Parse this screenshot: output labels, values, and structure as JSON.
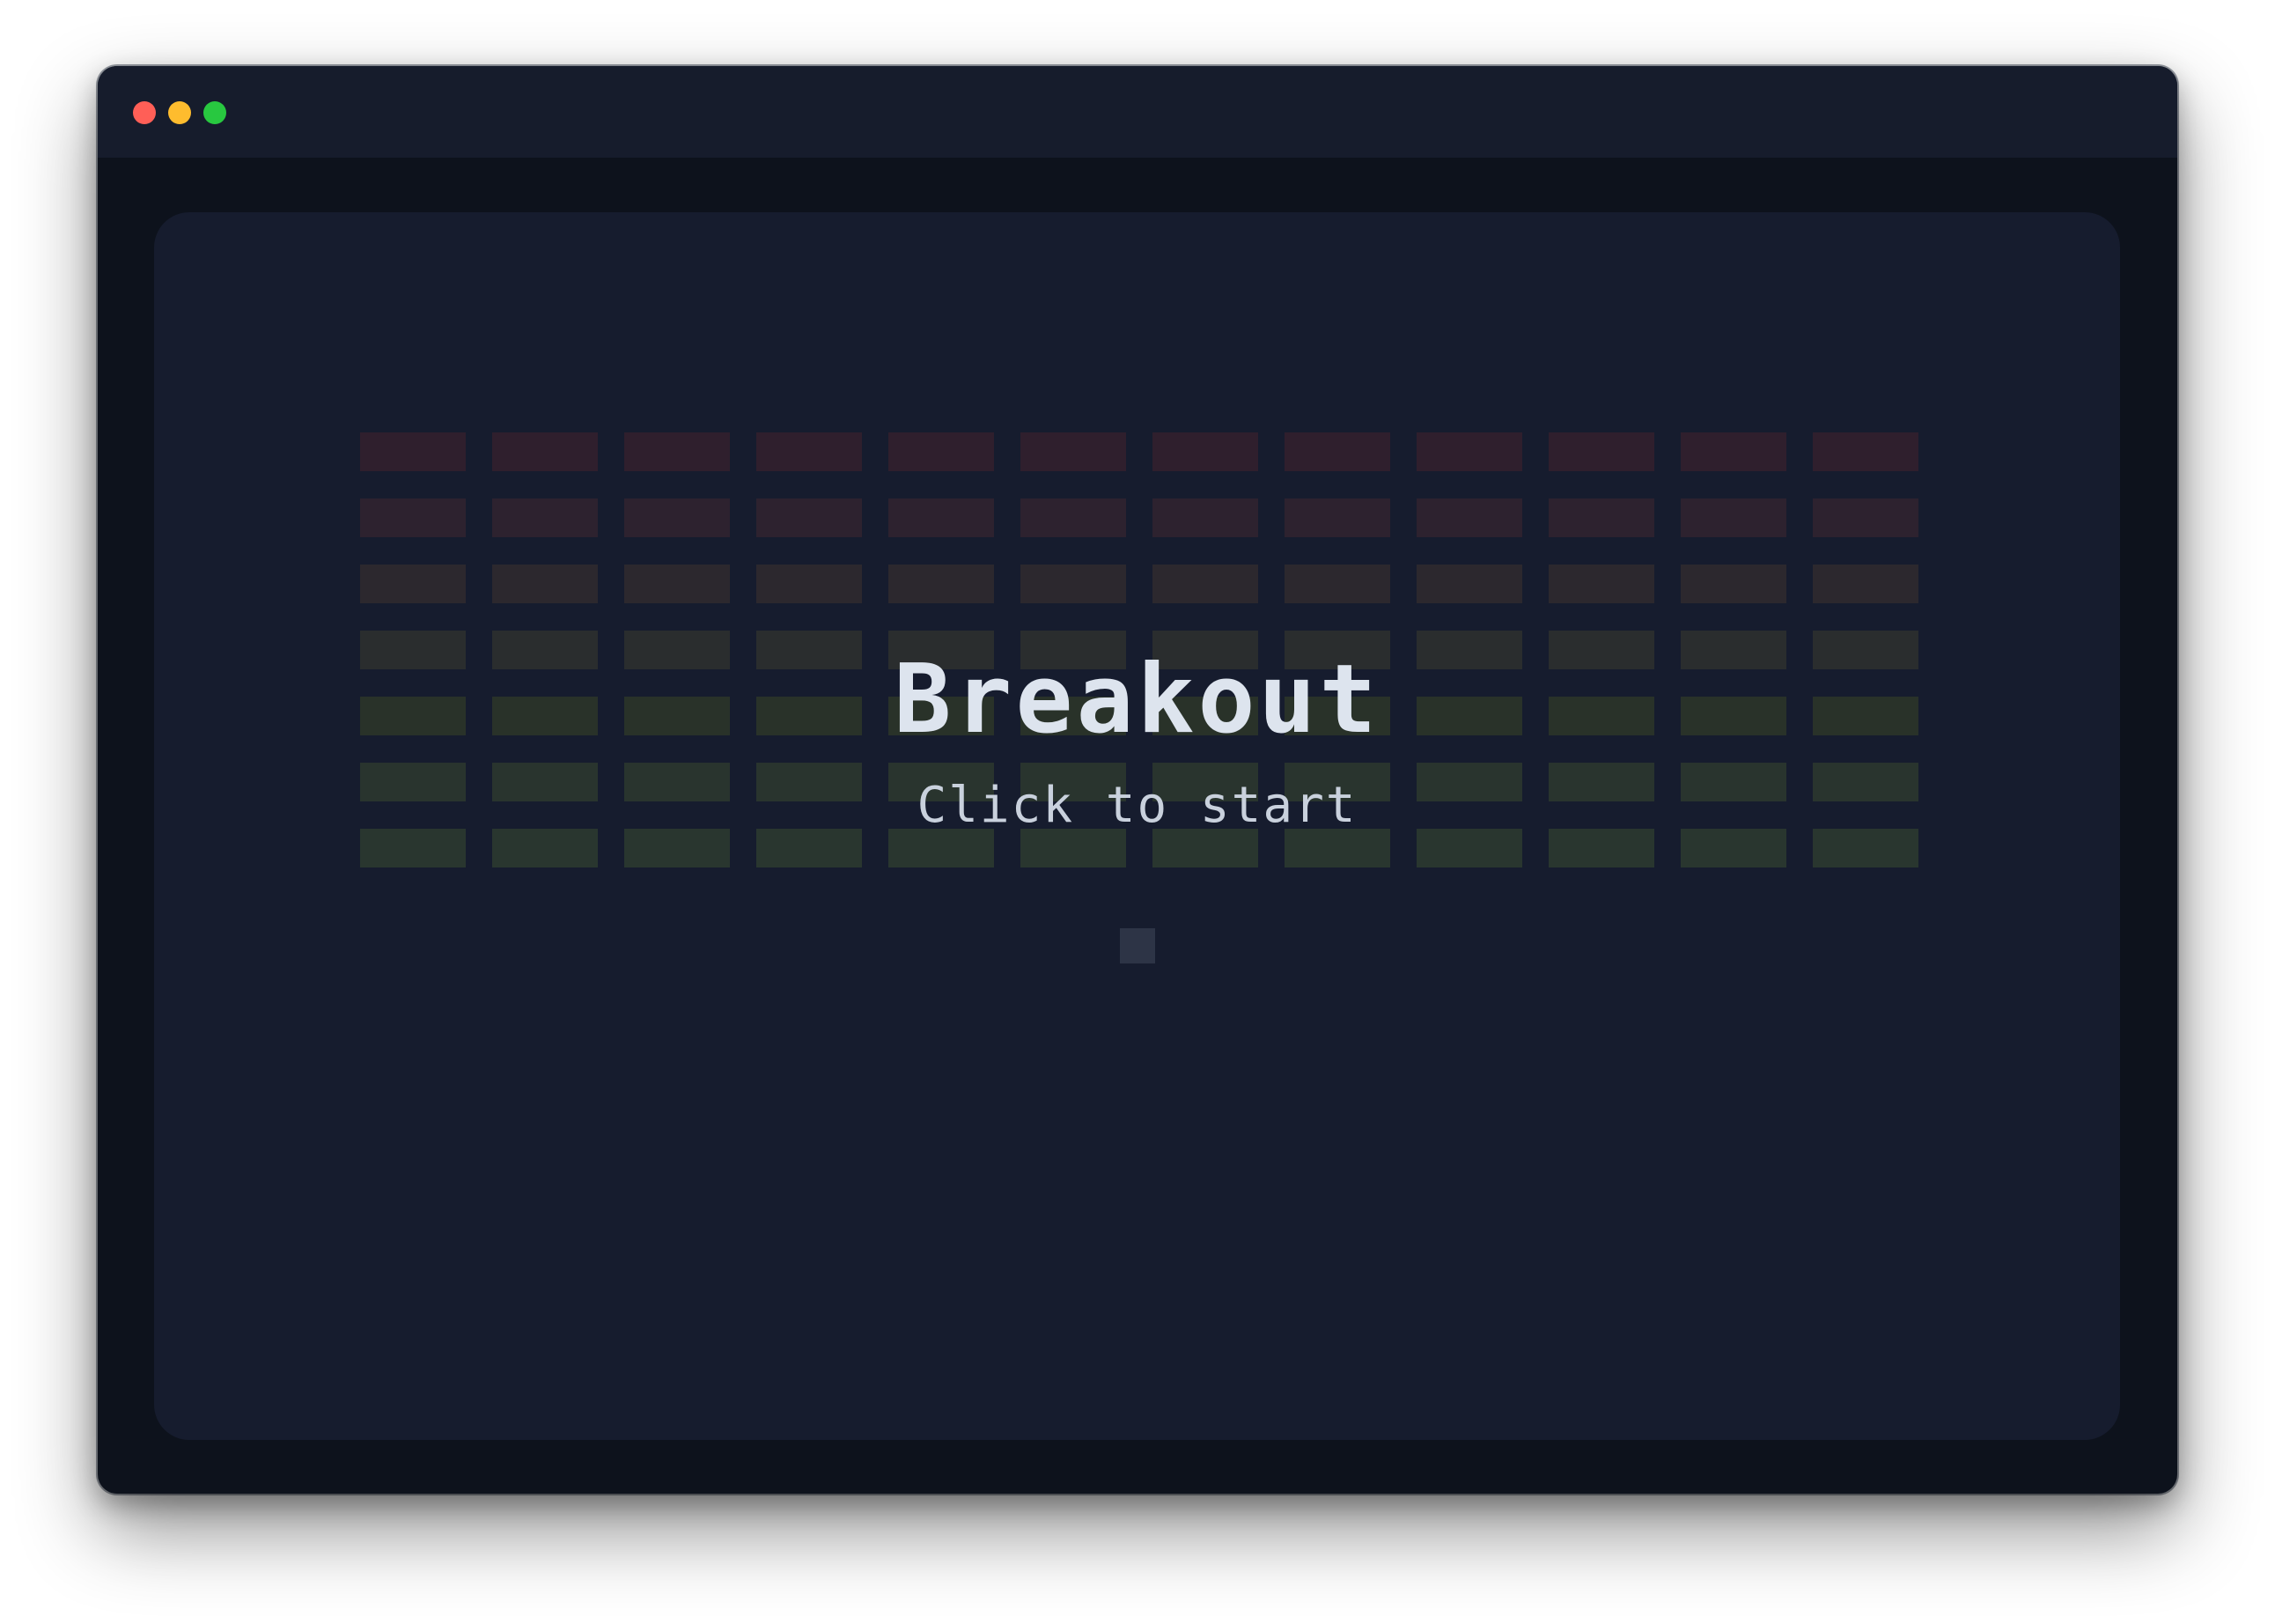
{
  "window": {
    "controls": [
      {
        "name": "close",
        "color": "#ff5f57"
      },
      {
        "name": "minimize",
        "color": "#febc2e"
      },
      {
        "name": "zoom",
        "color": "#28c840"
      }
    ]
  },
  "game": {
    "title": "Breakout",
    "prompt": "Click to start",
    "brick_grid": {
      "rows": 7,
      "columns": 12,
      "row_colors": [
        "#2f1f2d",
        "#2d222f",
        "#2c282e",
        "#2a2d2e",
        "#293229",
        "#29342e",
        "#29362f"
      ]
    },
    "ball_color": "#2d3446",
    "paddle_color": "#2f3648"
  }
}
